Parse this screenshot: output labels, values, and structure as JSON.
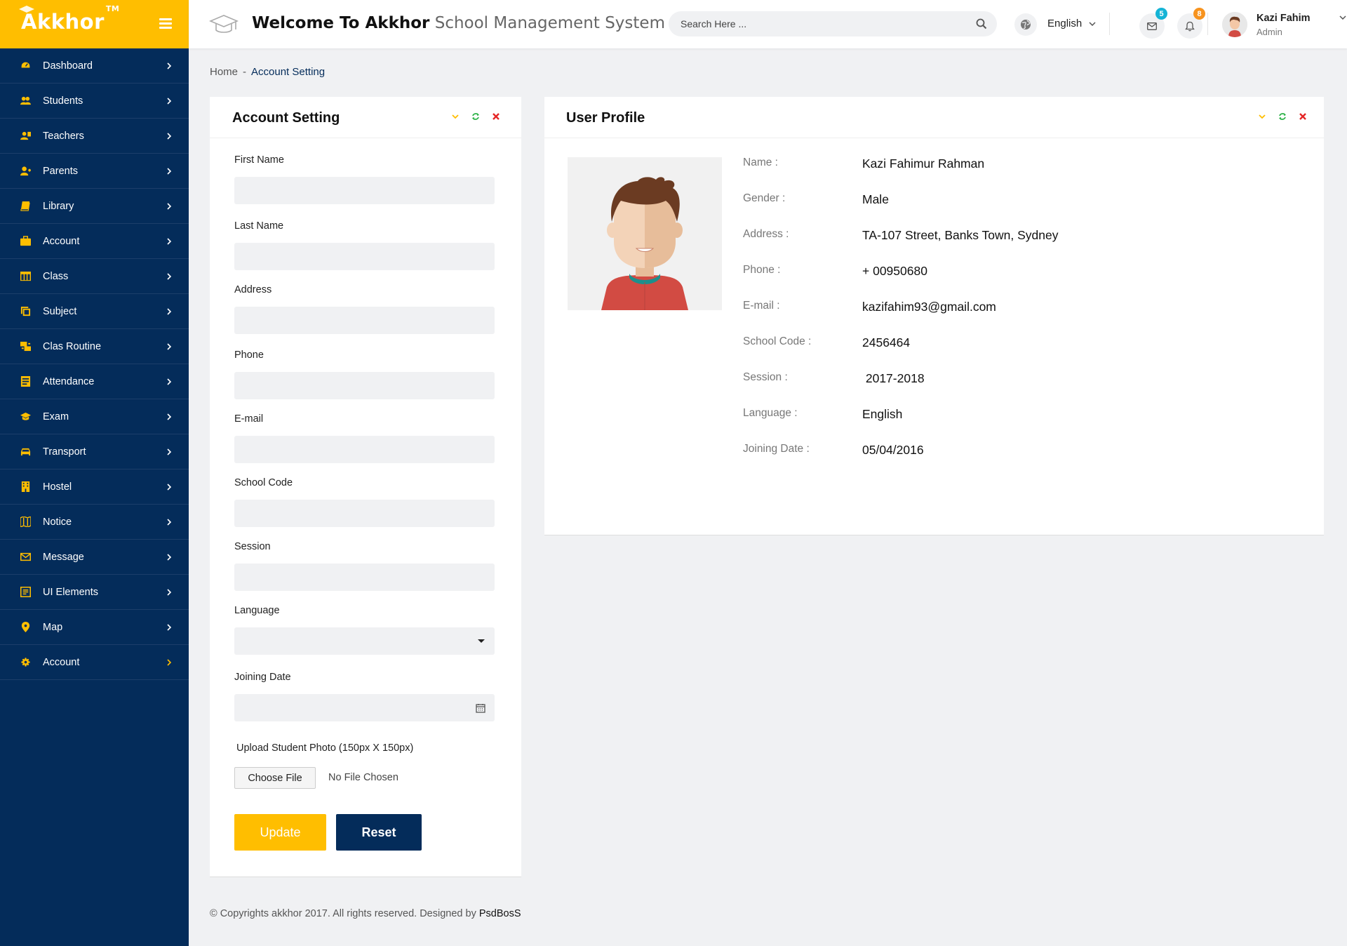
{
  "brand": {
    "name": "Akkhor",
    "tm": "TM",
    "accent": "#ffbe00",
    "navy": "#042c5a"
  },
  "sidebar": {
    "items": [
      {
        "label": "Dashboard",
        "icon": "dashboard-icon"
      },
      {
        "label": "Students",
        "icon": "students-icon"
      },
      {
        "label": "Teachers",
        "icon": "teachers-icon"
      },
      {
        "label": "Parents",
        "icon": "parents-icon"
      },
      {
        "label": "Library",
        "icon": "book-icon"
      },
      {
        "label": "Account",
        "icon": "briefcase-icon"
      },
      {
        "label": "Class",
        "icon": "table-icon"
      },
      {
        "label": "Subject",
        "icon": "copy-icon"
      },
      {
        "label": "Clas Routine",
        "icon": "routine-icon"
      },
      {
        "label": "Attendance",
        "icon": "attendance-icon"
      },
      {
        "label": "Exam",
        "icon": "graduation-cap-icon"
      },
      {
        "label": "Transport",
        "icon": "car-icon"
      },
      {
        "label": "Hostel",
        "icon": "building-icon"
      },
      {
        "label": "Notice",
        "icon": "map-icon"
      },
      {
        "label": "Message",
        "icon": "envelope-icon"
      },
      {
        "label": "UI Elements",
        "icon": "ui-icon"
      },
      {
        "label": "Map",
        "icon": "map-marker-icon"
      },
      {
        "label": "Account",
        "icon": "gear-icon",
        "active": true
      }
    ]
  },
  "header": {
    "title_bold": "Welcome To Akkhor",
    "title_rest": "School Management System",
    "search_placeholder": "Search Here ...",
    "language": "English",
    "messages_count": "5",
    "notifications_count": "8",
    "badge_colors": {
      "messages": "#15b4d6",
      "notifications": "#f7931e"
    },
    "user_name": "Kazi Fahim",
    "user_role": "Admin"
  },
  "breadcrumb": {
    "home": "Home",
    "separator": "-",
    "current": "Account Setting"
  },
  "account_form": {
    "title": "Account Setting",
    "fields": [
      {
        "label": "First Name",
        "value": ""
      },
      {
        "label": "Last Name",
        "value": ""
      },
      {
        "label": "Address",
        "value": ""
      },
      {
        "label": "Phone",
        "value": ""
      },
      {
        "label": "E-mail",
        "value": ""
      },
      {
        "label": "School Code",
        "value": ""
      },
      {
        "label": "Session",
        "value": ""
      },
      {
        "label": "Language",
        "value": ""
      },
      {
        "label": "Joining Date",
        "value": ""
      }
    ],
    "upload_label_prefix": "Upload Student Photo ",
    "upload_label_size": "(150px X 150px)",
    "choose_file": "Choose File",
    "no_file": "No File Chosen",
    "update": "Update",
    "reset": "Reset"
  },
  "profile": {
    "title": "User Profile",
    "rows": [
      {
        "label": "Name :",
        "value": "Kazi Fahimur Rahman"
      },
      {
        "label": "Gender :",
        "value": "Male"
      },
      {
        "label": "Address :",
        "value": "TA-107 Street, Banks Town, Sydney"
      },
      {
        "label": "Phone :",
        "value": "+ 00950680"
      },
      {
        "label": "E-mail :",
        "value": "kazifahim93@gmail.com"
      },
      {
        "label": "School Code :",
        "value": "2456464"
      },
      {
        "label": "Session :",
        "value": " 2017-2018"
      },
      {
        "label": "Language :",
        "value": "English"
      },
      {
        "label": "Joining Date :",
        "value": "05/04/2016"
      }
    ]
  },
  "footer": {
    "text": "© Copyrights akkhor 2017. All rights reserved. Designed by ",
    "designer": "PsdBosS"
  }
}
